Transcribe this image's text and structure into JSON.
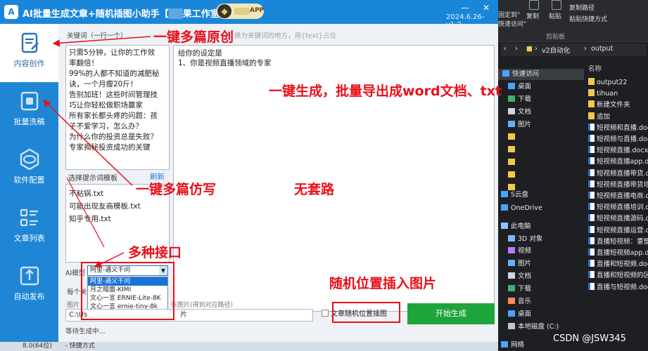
{
  "app": {
    "title": "AI批量生成文章+随机插图小助手【",
    "title_blurred": "▒▒",
    "title_tail": "果工作室】",
    "version": "2024.6.26-v1.2",
    "vip_badge": "APP",
    "minimize": "—",
    "close": "✕"
  },
  "sidebar": {
    "items": [
      {
        "label": "内容创作",
        "active": true,
        "icon": "doc-edit-icon"
      },
      {
        "label": "批量洗稿",
        "active": false,
        "icon": "brush-icon"
      },
      {
        "label": "软件配置",
        "active": false,
        "icon": "settings-icon"
      },
      {
        "label": "文章列表",
        "active": false,
        "icon": "list-icon"
      },
      {
        "label": "自动发布",
        "active": false,
        "icon": "upload-icon"
      }
    ]
  },
  "main": {
    "keywords_label": "关键词（一行一个）",
    "keywords": [
      "只需5分钟，让你的工作效",
      "率翻倍！",
      "99%的人都不知道的减肥秘",
      "诀，一个月瘦20斤！",
      "告别加班！这些时间管理技",
      "巧让你轻松做职场赢家",
      "所有家长都头疼的问题：孩",
      "子不爱学习，怎么办？",
      "为什么你的投资总是失败？",
      "专家揭秘投资成功的关键"
    ],
    "role_hint": "换为关键词的地方，用{text}占位",
    "role_lines": [
      "给你的设定是",
      "1、你是视频直播领域的专家"
    ],
    "template_label": "选择提示词模板",
    "refresh": "刷新",
    "templates": [
      "不粘锅.txt",
      "可能出现友商模板.txt",
      "知乎专用.txt"
    ],
    "model_label": "AI模型",
    "model_selected": "阿里-通义千问",
    "model_options": [
      "阿里-通义千问",
      "月之暗面-KIMI",
      "文心一言 ERNIE-Lite-8K",
      "文心一言 ernie-tiny-8k"
    ],
    "row_label": "每个关",
    "image_dir_label": "图片",
    "image_dir_hint": "张图片(得到对应路径)",
    "image_path": "C:\\Us",
    "image_path_suffix": "片",
    "random_insert_label": "文章随机位置插图",
    "start_button": "开始生成",
    "status": "等待生成中..."
  },
  "strip": {
    "left": "8.0(64位)",
    "right": "- 快捷方式"
  },
  "explorer": {
    "ribbon": {
      "pin_label": "固定到\"",
      "quick_access_label": "快速访问\"",
      "copy": "复制",
      "paste": "粘贴",
      "copy_path": "复制路径",
      "paste_shortcut": "粘贴快捷方式",
      "clipboard": "剪贴板"
    },
    "path": [
      "v2自动化",
      "output"
    ],
    "tree": [
      {
        "label": "快速访问",
        "type": "star"
      },
      {
        "label": "桌面",
        "type": "desktop"
      },
      {
        "label": "下载",
        "type": "download"
      },
      {
        "label": "文档",
        "type": "doc"
      },
      {
        "label": "图片",
        "type": "pic"
      },
      {
        "label": "",
        "type": "folder"
      },
      {
        "label": "",
        "type": "folder"
      },
      {
        "label": "",
        "type": "folder"
      },
      {
        "label": "",
        "type": "folder"
      },
      {
        "label": "",
        "type": "folder"
      },
      {
        "label": "S云盘",
        "type": "cloud"
      },
      {
        "label": "OneDrive",
        "type": "cloud"
      },
      {
        "label": "此电脑",
        "type": "pc"
      },
      {
        "label": "3D 对象",
        "type": "cube"
      },
      {
        "label": "视频",
        "type": "video"
      },
      {
        "label": "图片",
        "type": "pic"
      },
      {
        "label": "文档",
        "type": "doc"
      },
      {
        "label": "下载",
        "type": "download"
      },
      {
        "label": "音乐",
        "type": "music"
      },
      {
        "label": "桌面",
        "type": "desktop"
      },
      {
        "label": "本地磁盘 (C:)",
        "type": "disk"
      },
      {
        "label": "网络",
        "type": "net"
      }
    ],
    "name_header": "名称",
    "files": [
      {
        "name": "output22",
        "type": "folder"
      },
      {
        "name": "tihuan",
        "type": "folder"
      },
      {
        "name": "新建文件夹",
        "type": "folder"
      },
      {
        "name": "追加",
        "type": "folder"
      },
      {
        "name": "短视频和直播.docx",
        "type": "doc"
      },
      {
        "name": "短视频与直播.docx",
        "type": "doc"
      },
      {
        "name": "短视频直播.docx",
        "type": "doc"
      },
      {
        "name": "短视频直播app.docx",
        "type": "doc"
      },
      {
        "name": "短视频直播带货.docx",
        "type": "doc"
      },
      {
        "name": "短视频直播带货培训.docx",
        "type": "doc"
      },
      {
        "name": "短视频直播电商.docx",
        "type": "doc"
      },
      {
        "name": "短视频直播培训.docx",
        "type": "doc"
      },
      {
        "name": "短视频直播源码.docx",
        "type": "doc"
      },
      {
        "name": "短视频直播运营.docx",
        "type": "doc"
      },
      {
        "name": "直播短视频：重塑.docx",
        "type": "doc"
      },
      {
        "name": "直播短视频app.docx",
        "type": "doc"
      },
      {
        "name": "直播和短视频.docx",
        "type": "doc"
      },
      {
        "name": "直播和短视频的区别.docx",
        "type": "doc"
      },
      {
        "name": "直播与短视频.docx",
        "type": "doc"
      }
    ]
  },
  "annotations": {
    "a1": "一键多篇原创",
    "a2": "一键生成，批量导出成word文档、txt",
    "a3": "一键多篇仿写",
    "a4": "无套路",
    "a5": "多种接口",
    "a6": "随机位置插入图片",
    "color": "#e8101a"
  },
  "watermark": "CSDN @JSW345"
}
